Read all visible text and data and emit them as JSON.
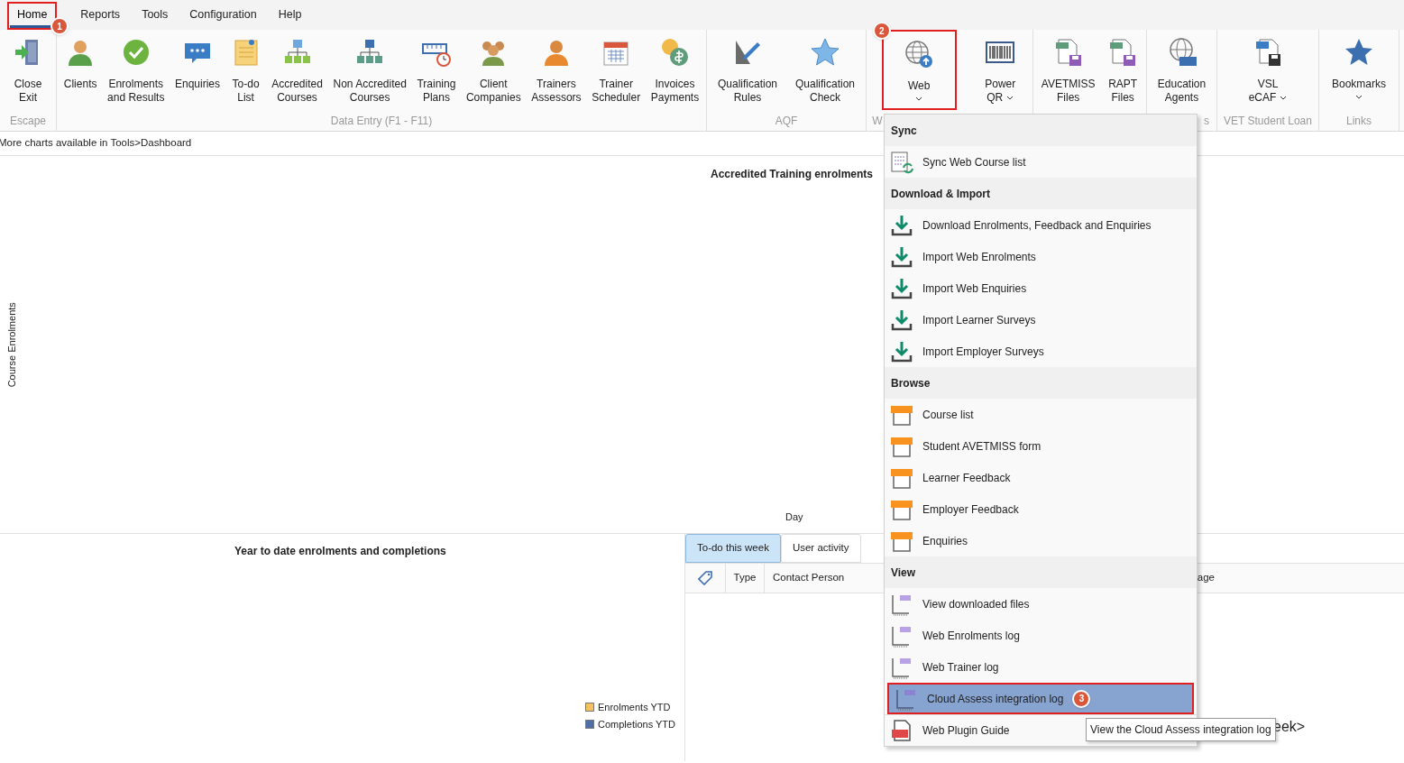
{
  "menu_tabs": [
    {
      "label": "Home",
      "selected": true,
      "badge": "1"
    },
    {
      "label": "Reports",
      "selected": false
    },
    {
      "label": "Tools",
      "selected": false
    },
    {
      "label": "Configuration",
      "selected": false
    },
    {
      "label": "Help",
      "selected": false
    }
  ],
  "ribbon_groups": [
    {
      "label": "Escape",
      "buttons": [
        {
          "lines": [
            "Close",
            "Exit"
          ],
          "kind": "exit",
          "dropdown": false
        }
      ]
    },
    {
      "label": "Data Entry (F1 - F11)",
      "buttons": [
        {
          "lines": [
            "Clients"
          ],
          "kind": "person",
          "dropdown": false
        },
        {
          "lines": [
            "Enrolments",
            "and Results"
          ],
          "kind": "check",
          "dropdown": false
        },
        {
          "lines": [
            "Enquiries"
          ],
          "kind": "chat",
          "dropdown": false
        },
        {
          "lines": [
            "To-do",
            "List"
          ],
          "kind": "note",
          "dropdown": false
        },
        {
          "lines": [
            "Accredited",
            "Courses"
          ],
          "kind": "tree-green",
          "dropdown": false
        },
        {
          "lines": [
            "Non Accredited",
            "Courses"
          ],
          "kind": "tree-blue",
          "dropdown": false
        },
        {
          "lines": [
            "Training",
            "Plans"
          ],
          "kind": "ruler-clock",
          "dropdown": false
        },
        {
          "lines": [
            "Client",
            "Companies"
          ],
          "kind": "people",
          "dropdown": false
        },
        {
          "lines": [
            "Trainers",
            "Assessors"
          ],
          "kind": "person-orange",
          "dropdown": false
        },
        {
          "lines": [
            "Trainer",
            "Scheduler"
          ],
          "kind": "calendar",
          "dropdown": false
        },
        {
          "lines": [
            "Invoices",
            "Payments"
          ],
          "kind": "coins",
          "dropdown": false
        }
      ]
    },
    {
      "label": "AQF",
      "buttons": [
        {
          "lines": [
            "Qualification",
            "Rules"
          ],
          "kind": "pen-ruler",
          "dropdown": false
        },
        {
          "lines": [
            "Qualification",
            "Check"
          ],
          "kind": "star-light",
          "dropdown": false
        }
      ]
    },
    {
      "label": "W",
      "buttons": [
        {
          "lines": [
            "Web"
          ],
          "kind": "globe-up",
          "dropdown": true,
          "badge": "2"
        },
        {
          "lines": [
            "Power",
            "QR"
          ],
          "kind": "barcode",
          "dropdown": true
        }
      ]
    },
    {
      "buttons": [
        {
          "lines": [
            "AVETMISS",
            "Files"
          ],
          "kind": "txt-file",
          "dropdown": false
        },
        {
          "lines": [
            "RAPT",
            "Files"
          ],
          "kind": "txt-file",
          "dropdown": false
        }
      ]
    },
    {
      "label": "s",
      "buttons": [
        {
          "lines": [
            "Education",
            "Agents"
          ],
          "kind": "globe-abc",
          "dropdown": false
        }
      ]
    },
    {
      "label": "VET Student Loan",
      "buttons": [
        {
          "lines": [
            "VSL",
            "eCAF"
          ],
          "kind": "csv-file",
          "dropdown": true
        }
      ]
    },
    {
      "label": "Links",
      "buttons": [
        {
          "lines": [
            "Bookmarks"
          ],
          "kind": "star",
          "dropdown": true
        }
      ]
    }
  ],
  "info_bar": "More charts available in Tools>Dashboard",
  "top_chart": {
    "title": "Accredited Training enrolments",
    "ylabel": "Course Enrolments",
    "xlabel": "Day"
  },
  "ytd_panel": {
    "title": "Year to date enrolments and completions",
    "legend": [
      {
        "label": "Enrolments YTD",
        "color": "#f7c160"
      },
      {
        "label": "Completions YTD",
        "color": "#4f6fa8"
      }
    ]
  },
  "activity_panel": {
    "tabs": [
      {
        "label": "To-do this week",
        "selected": true
      },
      {
        "label": "User activity",
        "selected": false
      }
    ],
    "columns": [
      "Type",
      "Contact Person",
      "age"
    ],
    "fragment": "eek>"
  },
  "web_menu": {
    "sections": [
      {
        "title": "Sync",
        "items": [
          {
            "label": "Sync Web Course list",
            "kind": "sync",
            "selected": false
          }
        ]
      },
      {
        "title": "Download & Import",
        "items": [
          {
            "label": "Download Enrolments, Feedback and Enquiries",
            "kind": "download",
            "selected": false
          },
          {
            "label": "Import Web Enrolments",
            "kind": "download",
            "selected": false
          },
          {
            "label": "Import Web Enquiries",
            "kind": "download",
            "selected": false
          },
          {
            "label": "Import Learner Surveys",
            "kind": "download",
            "selected": false
          },
          {
            "label": "Import Employer Surveys",
            "kind": "download",
            "selected": false
          }
        ]
      },
      {
        "title": "Browse",
        "items": [
          {
            "label": "Course list",
            "kind": "html",
            "selected": false
          },
          {
            "label": "Student AVETMISS form",
            "kind": "html",
            "selected": false
          },
          {
            "label": "Learner Feedback",
            "kind": "html",
            "selected": false
          },
          {
            "label": "Employer Feedback",
            "kind": "html",
            "selected": false
          },
          {
            "label": "Enquiries",
            "kind": "html",
            "selected": false
          }
        ]
      },
      {
        "title": "View",
        "items": [
          {
            "label": "View downloaded files",
            "kind": "log",
            "selected": false
          },
          {
            "label": "Web Enrolments log",
            "kind": "log",
            "selected": false
          },
          {
            "label": "Web Trainer log",
            "kind": "log",
            "selected": false
          },
          {
            "label": "Cloud Assess integration log",
            "kind": "log",
            "selected": true,
            "badge": "3"
          },
          {
            "label": "Web Plugin Guide",
            "kind": "pdf",
            "selected": false
          }
        ]
      }
    ],
    "tooltip": "View the Cloud Assess integration log"
  }
}
